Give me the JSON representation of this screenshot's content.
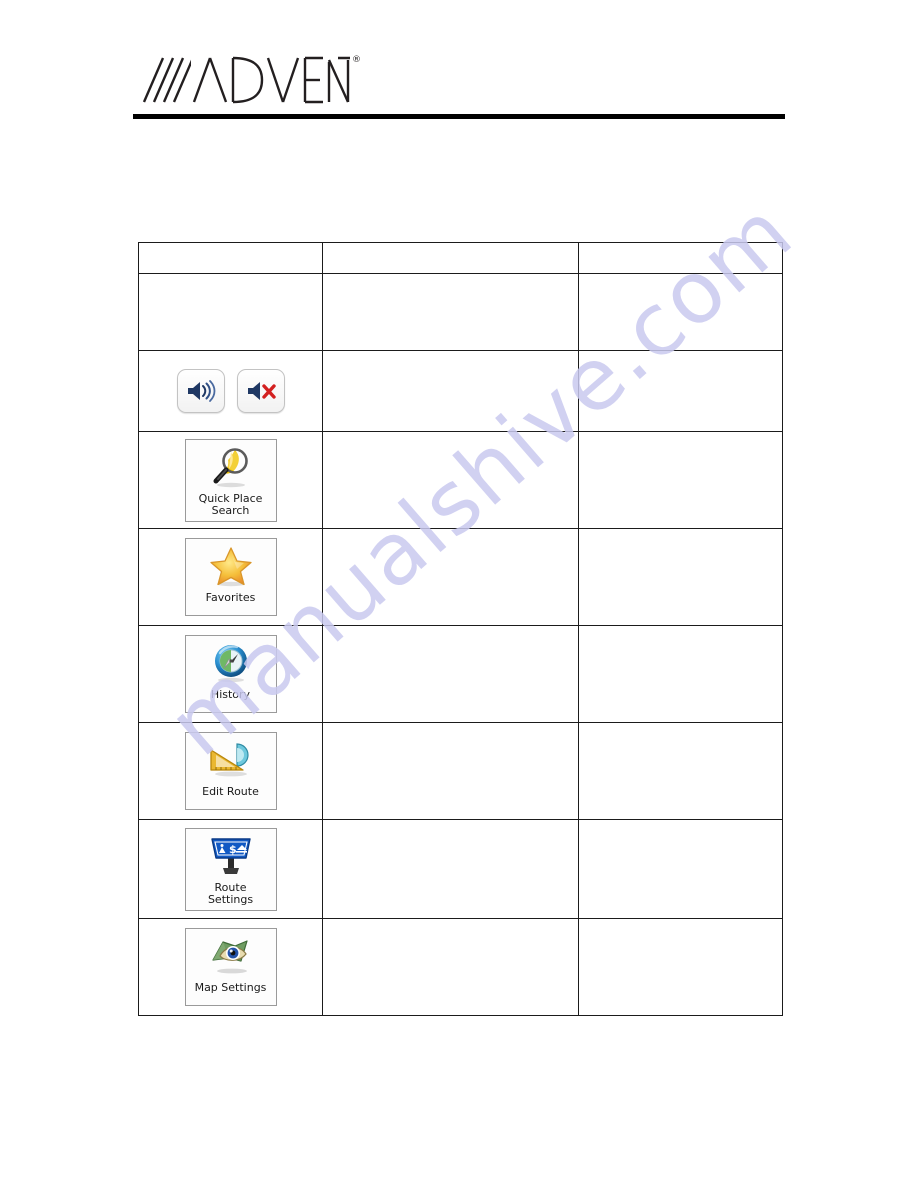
{
  "document": {
    "brand": "ADVENT",
    "brand_slashes": "////",
    "registered_mark": "®",
    "watermark": "manualshive.com"
  },
  "table": {
    "columns": [
      {
        "id": "icon",
        "header": ""
      },
      {
        "id": "mid",
        "header": ""
      },
      {
        "id": "right",
        "header": ""
      }
    ],
    "rows": [
      {
        "name": "header-row",
        "type": "header",
        "cells": [
          "",
          "",
          ""
        ]
      },
      {
        "name": "intro-row",
        "type": "text",
        "cells": [
          "",
          "",
          ""
        ]
      },
      {
        "name": "volume-row",
        "type": "speaker-buttons",
        "icons": [
          {
            "name": "volume-on-icon",
            "label": ""
          },
          {
            "name": "volume-mute-icon",
            "label": ""
          }
        ],
        "cells": [
          "",
          ""
        ]
      },
      {
        "name": "quick-place-search-row",
        "type": "tile",
        "tile": {
          "icon": "magnifier-icon",
          "label": "Quick Place\nSearch"
        },
        "cells": [
          "",
          ""
        ]
      },
      {
        "name": "favorites-row",
        "type": "tile",
        "tile": {
          "icon": "star-icon",
          "label": "Favorites"
        },
        "cells": [
          "",
          ""
        ]
      },
      {
        "name": "history-row",
        "type": "tile",
        "tile": {
          "icon": "compass-globe-icon",
          "label": "History"
        },
        "cells": [
          "",
          ""
        ]
      },
      {
        "name": "edit-route-row",
        "type": "tile",
        "tile": {
          "icon": "ruler-protractor-icon",
          "label": "Edit Route"
        },
        "cells": [
          "",
          ""
        ]
      },
      {
        "name": "route-settings-row",
        "type": "tile",
        "tile": {
          "icon": "road-sign-icon",
          "label": "Route\nSettings"
        },
        "cells": [
          "",
          ""
        ]
      },
      {
        "name": "map-settings-row",
        "type": "tile",
        "tile": {
          "icon": "map-eye-icon",
          "label": "Map Settings"
        },
        "cells": [
          "",
          ""
        ]
      }
    ]
  },
  "colors": {
    "rule": "#000000",
    "table_border": "#1b1b1b",
    "watermark": "#c9c9ef",
    "speaker_navy": "#1f3864",
    "mute_red": "#d32020",
    "star_gold": "#f2c23c",
    "sign_blue": "#1159c4",
    "map_green": "#5d8a52",
    "ruler_yellow": "#e8b830"
  }
}
